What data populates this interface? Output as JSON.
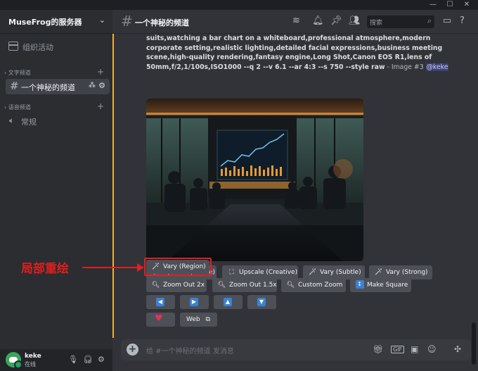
{
  "window": {
    "minimize": "—",
    "maximize": "☐",
    "close": "✕"
  },
  "server": {
    "name": "MuseFrog的服务器",
    "chevron": "⌄"
  },
  "sidebar": {
    "events_label": "组织活动",
    "text_category": "文字频道",
    "voice_category": "语音频道",
    "active_channel": "一个神秘的频道",
    "voice_channel": "常规"
  },
  "user": {
    "name": "keke",
    "status": "在线"
  },
  "channel": {
    "title": "一个神秘的频道"
  },
  "search": {
    "placeholder": "搜索"
  },
  "message": {
    "text": "suits,watching a bar chart on a whiteboard,professional atmosphere,modern corporate setting,realistic lighting,detailed facial expressions,business meeting scene,high-quality rendering,fantasy engine,Long Shot,Canon EOS R1,lens of 50mm,f/2,1/100s,ISO1000 --q 2 --v 6.1 --ar 4:3 --s 750 --style raw",
    "meta": " - Image #3 ",
    "mention": "@keke"
  },
  "buttons": {
    "upscale_subtle": "Upscale (Subtle)",
    "upscale_creative": "Upscale (Creative)",
    "vary_subtle": "Vary (Subtle)",
    "vary_strong": "Vary (Strong)",
    "vary_region": "Vary (Region)",
    "zoom_out_2x": "Zoom Out 2x",
    "zoom_out_15x": "Zoom Out 1.5x",
    "custom_zoom": "Custom Zoom",
    "make_square": "Make Square",
    "web": "Web"
  },
  "annotation": {
    "label": "局部重绘"
  },
  "composer": {
    "placeholder": "给 #一个神秘的频道 发消息"
  },
  "colors": {
    "accent_bar": "#f0b232",
    "annotation": "#e01e1e",
    "button": "#4e5058",
    "arrow_square": "#3b82d1"
  }
}
